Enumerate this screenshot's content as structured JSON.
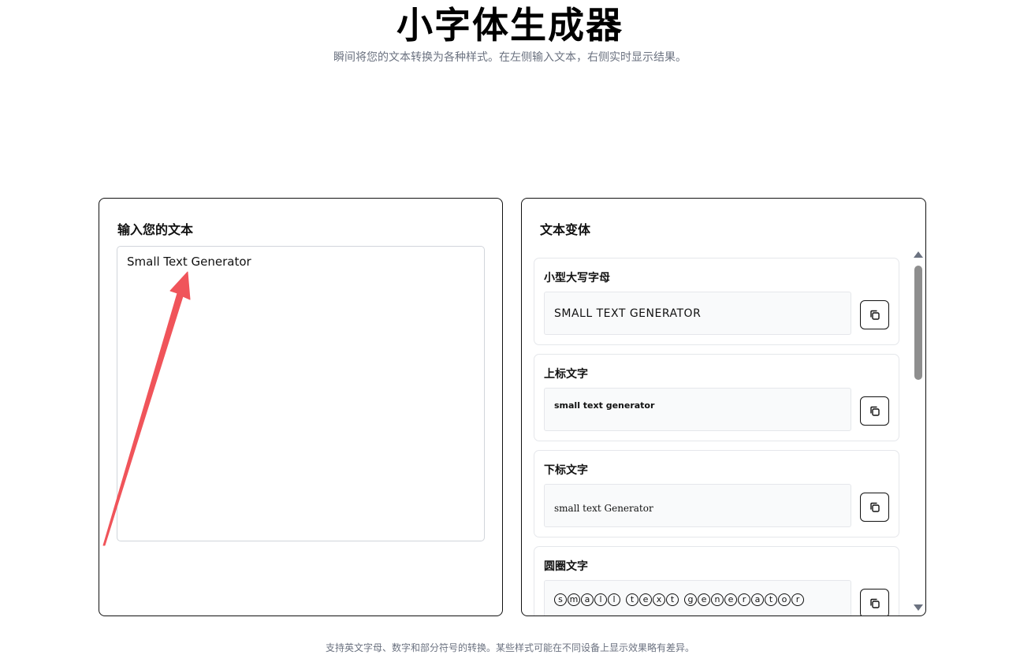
{
  "header": {
    "title": "小字体生成器",
    "subtitle": "瞬间将您的文本转换为各种样式。在左侧输入文本，右侧实时显示结果。"
  },
  "input_panel": {
    "heading": "输入您的文本",
    "value": "Small Text Generator"
  },
  "variants_panel": {
    "heading": "文本变体",
    "variants": [
      {
        "label": "小型大写字母",
        "output": "SMALL TEXT GENERATOR"
      },
      {
        "label": "上标文字",
        "output": "small text generator"
      },
      {
        "label": "下标文字",
        "output": "small text Generator"
      },
      {
        "label": "圆圈文字",
        "output": "small text generator"
      }
    ]
  },
  "icons": {
    "copy": "copy-icon"
  },
  "footer": {
    "note": "支持英文字母、数字和部分符号的转换。某些样式可能在不同设备上显示效果略有差异。"
  },
  "colors": {
    "annotation_arrow": "#f0545a",
    "muted_text": "#6b7280"
  }
}
